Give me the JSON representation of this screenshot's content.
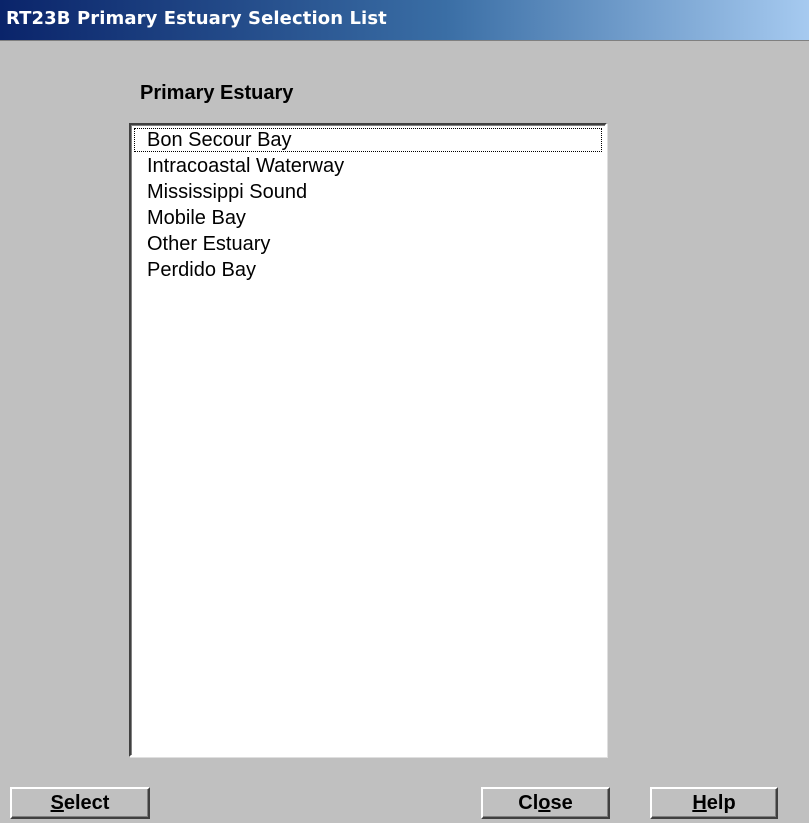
{
  "window": {
    "title": "RT23B Primary Estuary Selection List"
  },
  "list": {
    "heading": "Primary Estuary",
    "items": [
      {
        "label": "Bon Secour Bay",
        "focused": true
      },
      {
        "label": "Intracoastal Waterway",
        "focused": false
      },
      {
        "label": "Mississippi Sound",
        "focused": false
      },
      {
        "label": "Mobile Bay",
        "focused": false
      },
      {
        "label": "Other Estuary",
        "focused": false
      },
      {
        "label": "Perdido Bay",
        "focused": false
      }
    ]
  },
  "buttons": {
    "select": {
      "mnemonic": "S",
      "rest": "elect"
    },
    "close": {
      "pre": "Cl",
      "mnemonic": "o",
      "rest": "se"
    },
    "help": {
      "mnemonic": "H",
      "rest": "elp"
    }
  },
  "colors": {
    "window_bg": "#c0c0c0",
    "title_start": "#0a246a",
    "title_end": "#a6caf0",
    "list_bg": "#ffffff"
  }
}
